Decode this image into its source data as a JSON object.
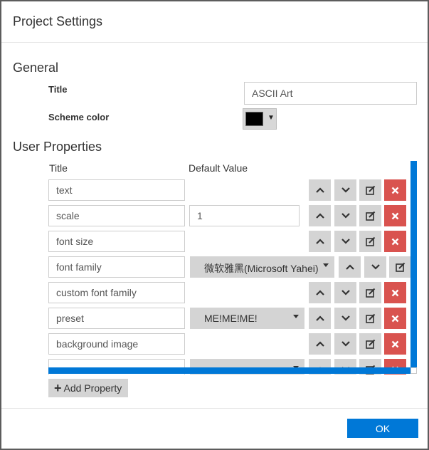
{
  "dialog": {
    "title": "Project Settings"
  },
  "general": {
    "section_title": "General",
    "title_label": "Title",
    "title_value": "ASCII Art",
    "scheme_color_label": "Scheme color",
    "scheme_color_value": "#000000"
  },
  "user_properties": {
    "section_title": "User Properties",
    "col_title": "Title",
    "col_default_value": "Default Value",
    "rows": [
      {
        "title": "text",
        "kind": "none",
        "value": ""
      },
      {
        "title": "scale",
        "kind": "input",
        "value": "1"
      },
      {
        "title": "font size",
        "kind": "none",
        "value": ""
      },
      {
        "title": "font family",
        "kind": "select",
        "value": "微软雅黑(Microsoft Yahei)"
      },
      {
        "title": "custom font family",
        "kind": "none",
        "value": ""
      },
      {
        "title": "preset",
        "kind": "select",
        "value": "ME!ME!ME!"
      },
      {
        "title": "background image",
        "kind": "none",
        "value": ""
      },
      {
        "title": "",
        "kind": "select",
        "value": ""
      }
    ],
    "add_button": "Add Property"
  },
  "footer": {
    "ok_label": "OK"
  },
  "colors": {
    "accent": "#0078d7",
    "danger": "#d9534f",
    "button_gray": "#d4d4d4"
  },
  "icons": {
    "up": "chevron-up-icon",
    "down": "chevron-down-icon",
    "edit": "edit-icon",
    "delete": "close-icon",
    "add": "plus-icon"
  }
}
